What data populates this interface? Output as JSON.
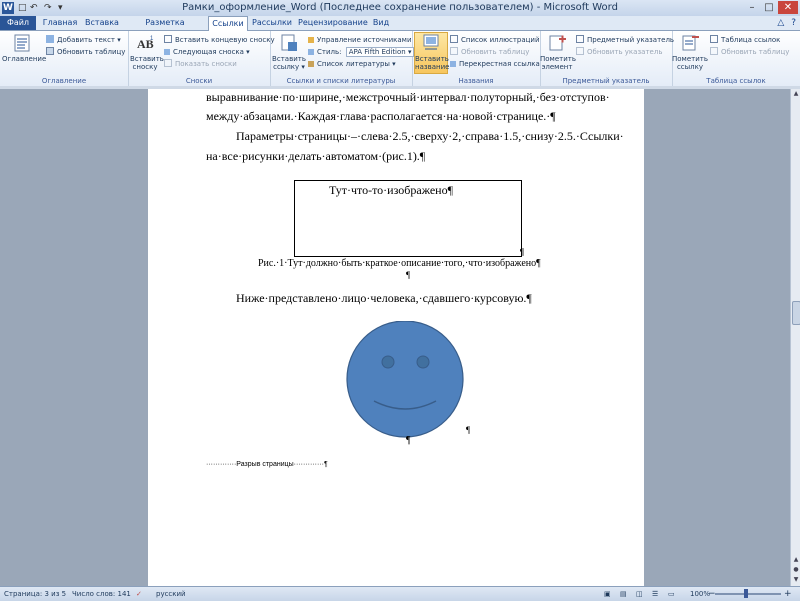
{
  "window": {
    "title": "Рамки_оформление_Word (Последнее сохранение пользователем)  -  Microsoft Word",
    "app_icon": "W",
    "qat_save": "□",
    "qat_undo": "↶",
    "qat_redo": "↷",
    "minimize": "–",
    "maximize": "□",
    "close": "✕"
  },
  "tabs": [
    {
      "label": "Файл"
    },
    {
      "label": "Главная"
    },
    {
      "label": "Вставка"
    },
    {
      "label": "Разметка страницы"
    },
    {
      "label": "Ссылки"
    },
    {
      "label": "Рассылки"
    },
    {
      "label": "Рецензирование"
    },
    {
      "label": "Вид"
    }
  ],
  "help": {
    "collapse": "△",
    "help": "?"
  },
  "ribbon": {
    "toc": {
      "group_label": "Оглавление",
      "toc_button": "Оглавление",
      "add_text": "Добавить текст ▾",
      "update_table": "Обновить таблицу"
    },
    "footnotes": {
      "group_label": "Сноски",
      "insert_footnote": "Вставить сноску",
      "insert_endnote": "Вставить концевую сноску",
      "next_footnote": "Следующая сноска ▾",
      "show_notes": "Показать сноски"
    },
    "citations": {
      "group_label": "Ссылки и списки литературы",
      "insert_citation": "Вставить ссылку ▾",
      "manage_sources": "Управление источниками",
      "style_label": "Стиль:",
      "style_value": "APA Fifth Edition ▾",
      "bibliography": "Список литературы ▾"
    },
    "captions": {
      "group_label": "Названия",
      "insert_caption": "Вставить название",
      "insert_table_figures": "Список иллюстраций",
      "update_table": "Обновить таблицу",
      "cross_reference": "Перекрестная ссылка"
    },
    "index": {
      "group_label": "Предметный указатель",
      "mark_entry": "Пометить элемент",
      "insert_index": "Предметный указатель",
      "update_index": "Обновить указатель"
    },
    "authorities": {
      "group_label": "Таблица ссылок",
      "mark_citation": "Пометить ссылку",
      "insert_table": "Таблица ссылок",
      "update_table": "Обновить таблицу"
    }
  },
  "document": {
    "line1": "выравнивание·по·ширине,·межстрочный·интервал·полуторный,·без·отступов·",
    "line2": "между·абзацами.·Каждая·глава·располагается·на·новой·странице.·¶",
    "line3": "Параметры·страницы·–·слева·2.5,·сверху·2,·справа·1.5,·снизу·2.5.·Ссылки·",
    "line4": "на·все·рисунки·делать·автоматом·(рис.1).¶",
    "frame_text": "Тут·что-то·изображено¶",
    "frame_mark": "¶",
    "caption": "Рис.·1·Тут·должно·быть·краткое·описание·того,·что·изображено¶",
    "caption_mark": "¶",
    "line5": "Ниже·представлено·лицо·человека,·сдавшего·курсовую.¶",
    "face_mark_right": "¶",
    "face_mark_bottom": "¶",
    "page_break": "·············Разрыв страницы·············¶"
  },
  "statusbar": {
    "page": "Страница: 3 из 5",
    "words": "Число слов: 141",
    "language": "русский",
    "zoom": "100%",
    "zoom_out": "−",
    "zoom_in": "+"
  },
  "zoom_level": 1.0,
  "colors": {
    "face_fill": "#4f81bd",
    "face_stroke": "#385d8a",
    "file_tab": "#2a5597"
  }
}
